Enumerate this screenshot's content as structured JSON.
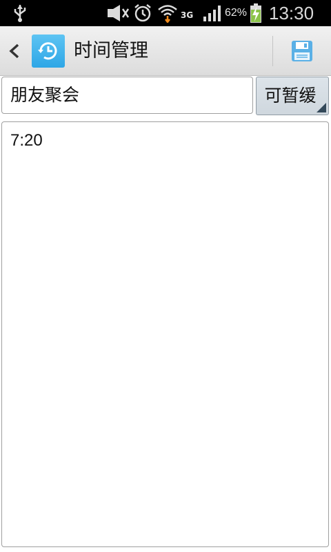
{
  "status_bar": {
    "network_type": "3G",
    "battery_percent": "62%",
    "time": "13:30",
    "icons": [
      "usb-icon",
      "mute-icon",
      "alarm-icon",
      "wifi-icon",
      "signal-icon",
      "battery-charging-icon"
    ]
  },
  "action_bar": {
    "title": "时间管理",
    "icons": [
      "back-icon",
      "clock-history-icon",
      "save-icon"
    ]
  },
  "form": {
    "name_value": "朋友聚会",
    "priority_selected": "可暂缓"
  },
  "content": {
    "text": "7:20"
  },
  "colors": {
    "status_bar_bg": "#000000",
    "action_bar_bg": "#e6e6e6",
    "app_icon_blue": "#3aa9e8",
    "save_icon_blue": "#5ab0e6",
    "spinner_bg": "#d5dde3"
  }
}
